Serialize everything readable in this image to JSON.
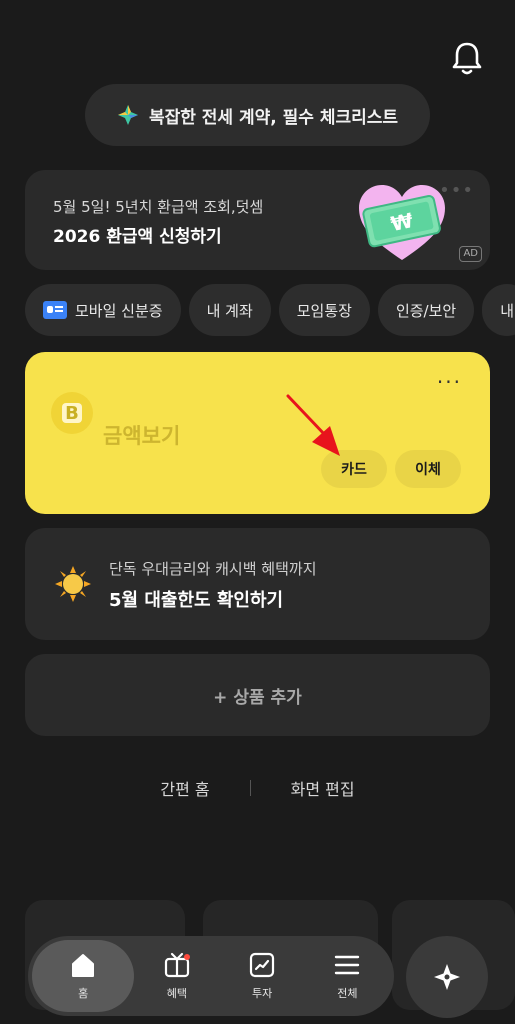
{
  "banner": {
    "text": "복잡한 전세 계약, 필수 체크리스트"
  },
  "ad": {
    "subtitle": "5월 5일! 5년치 환급액 조회,덧셈",
    "title": "2026 환급액 신청하기",
    "badge": "AD",
    "currency_symbol": "₩"
  },
  "chips": [
    {
      "label": "모바일 신분증"
    },
    {
      "label": "내 계좌"
    },
    {
      "label": "모임통장"
    },
    {
      "label": "인증/보안"
    },
    {
      "label": "내"
    }
  ],
  "account": {
    "logo_letter": "B",
    "amount_label": "금액보기",
    "more": "···",
    "card_button": "카드",
    "transfer_button": "이체"
  },
  "loan": {
    "subtitle": "단독 우대금리와 캐시백 혜택까지",
    "title": "5월 대출한도 확인하기"
  },
  "add_product": {
    "label": "+ 상품 추가"
  },
  "links": {
    "simple_home": "간편 홈",
    "edit_screen": "화면 편집"
  },
  "nav": {
    "home": "홈",
    "benefits": "혜택",
    "invest": "투자",
    "all": "전체"
  },
  "colors": {
    "background": "#1b1b1b",
    "card": "#2a2a2a",
    "account_card": "#f7e24c",
    "annotation_arrow": "#e8141c",
    "notification_dot": "#ff4a3d"
  }
}
